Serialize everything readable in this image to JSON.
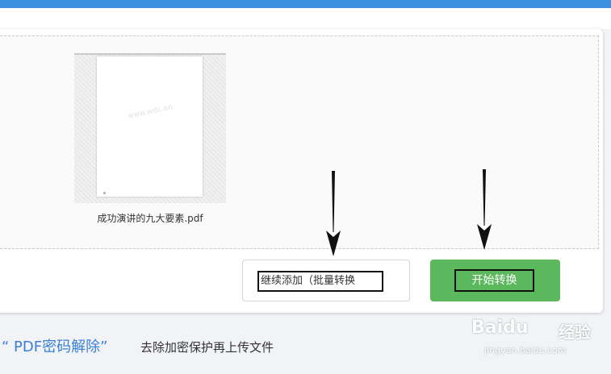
{
  "upload": {
    "file_name": "成功演讲的九大要素.pdf",
    "thumb_watermark": "www.wdc.an"
  },
  "actions": {
    "add_label": "继续添加（批量转换",
    "start_label": "开始转换"
  },
  "footer": {
    "title": "“ PDF密码解除”",
    "desc": "去除加密保护再上传文件"
  },
  "watermark": {
    "logo": "Baidu",
    "logo_cn": "经验",
    "url": "jingyan.baidu.com"
  },
  "colors": {
    "accent_blue": "#3d8fe0",
    "start_green": "#5cb85c",
    "footer_link": "#3a80d5"
  }
}
